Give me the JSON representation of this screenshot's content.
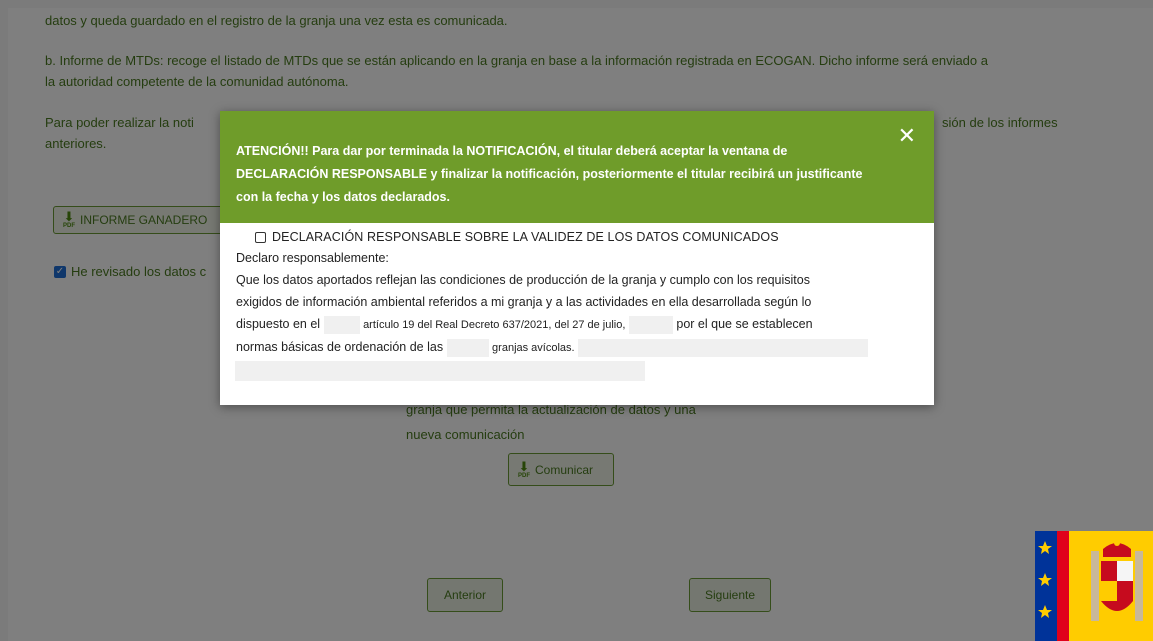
{
  "background": {
    "line1": "datos y queda guardado en el registro de la granja una vez esta es comunicada.",
    "para_b_1": "b. Informe de MTDs: recoge el listado de MTDs que se están aplicando en la granja en base a la información registrada en ECOGAN. Dicho informe será enviado a",
    "para_b_2": "la autoridad competente de la comunidad autónoma.",
    "para_c_1": "Para poder realizar la noti",
    "para_c_1_end": "sión de los informes",
    "para_c_2": "anteriores.",
    "informe_ganadero_label": "INFORME GANADERO",
    "revisado_label": "He revisado los datos c",
    "granja_line1": "granja que permita la actualización de datos y una",
    "granja_line2": "nueva comunicación",
    "comunicar_label": "Comunicar",
    "anterior_label": "Anterior",
    "siguiente_label": "Siguiente"
  },
  "modal": {
    "header_text": "ATENCIÓN!! Para dar por terminada la NOTIFICACIÓN, el titular deberá aceptar la ventana de DECLARACIÓN RESPONSABLE y finalizar la notificación, posteriormente el titular recibirá un justificante con la fecha y los datos declarados.",
    "close_symbol": "✕",
    "declaration_label": "DECLARACIÓN RESPONSABLE SOBRE LA VALIDEZ DE LOS DATOS COMUNICADOS",
    "declaro": "Declaro responsablemente:",
    "body_line1": "Que los datos aportados reflejan las condiciones de producción de la granja y cumplo con los requisitos",
    "body_line2": "exigidos de información ambiental referidos a mi granja y a las actividades en ella desarrollada según lo",
    "body_line3_a": "dispuesto en el",
    "body_line3_b": "artículo 19 del Real Decreto 637/2021, del 27 de julio,",
    "body_line3_c": "por el que se establecen",
    "body_line4_a": "normas básicas de ordenación de las",
    "body_line4_b": "granjas avícolas."
  },
  "colors": {
    "header_green": "#6f9c2a",
    "text_green": "#4a7a20",
    "checkbox_blue": "#1e6fd6"
  },
  "icons": {
    "pdf": "pdf-download-icon",
    "close": "close-icon",
    "flag": "spain-flag-emblem"
  }
}
